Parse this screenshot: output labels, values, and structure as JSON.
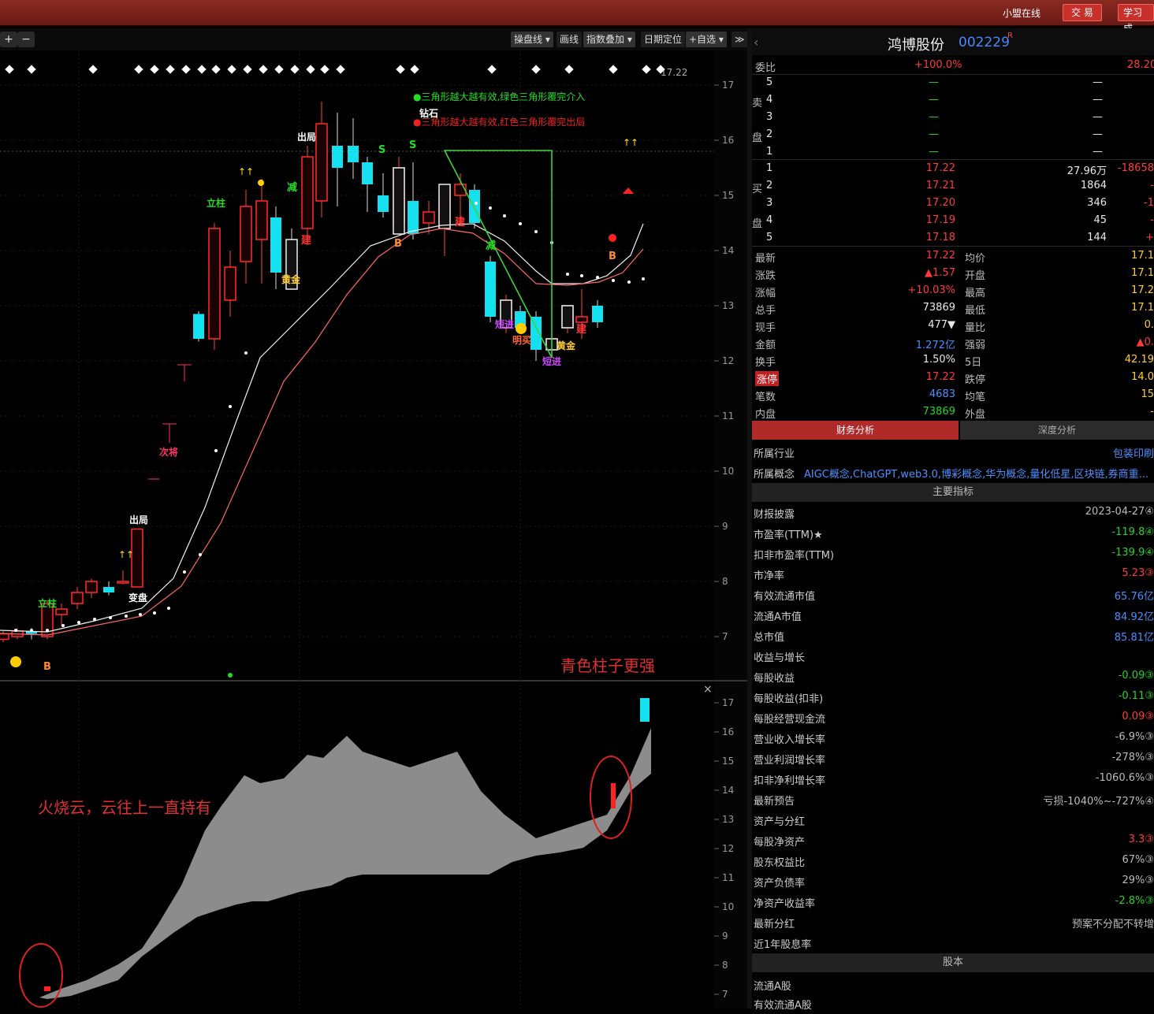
{
  "topbar": {
    "online": "小盟在线",
    "trade": "交 易",
    "learn": "学习成"
  },
  "toolbar": {
    "zoom_in": "+",
    "zoom_out": "−",
    "items": [
      "操盘线 ▾",
      "画线",
      "指数叠加 ▾",
      "日期定位",
      "+自选 ▾"
    ],
    "close": "≫"
  },
  "chart_data": {
    "type": "candlestick",
    "main": {
      "y_ticks": [
        17,
        16,
        15,
        14,
        13,
        12,
        11,
        10,
        9,
        8,
        7
      ],
      "current_price_label": "17.22",
      "legend": [
        {
          "text": "●三角形越大越有效,绿色三角形覆完介入",
          "color": "#22dd22"
        },
        {
          "text": "●三角形越大越有效,红色三角形覆完出局",
          "color": "#ee2222"
        }
      ],
      "annotations": [
        {
          "text": "钻石",
          "color": "#ffffff"
        },
        {
          "text": "出局",
          "color": "#ffffff"
        },
        {
          "text": "出局",
          "color": "#ffffff"
        },
        {
          "text": "立柱",
          "color": "#22dd22"
        },
        {
          "text": "立柱",
          "color": "#22dd22"
        },
        {
          "text": "减",
          "color": "#22dd22"
        },
        {
          "text": "减",
          "color": "#22dd22"
        },
        {
          "text": "建",
          "color": "#ff3333"
        },
        {
          "text": "建",
          "color": "#ff3333"
        },
        {
          "text": "建",
          "color": "#ff3333"
        },
        {
          "text": "黄金",
          "color": "#ffcc33"
        },
        {
          "text": "黄金",
          "color": "#ffcc33"
        },
        {
          "text": "变盘",
          "color": "#ffffff"
        },
        {
          "text": "次将",
          "color": "#ff3366"
        },
        {
          "text": "短进",
          "color": "#cc44ff"
        },
        {
          "text": "短进",
          "color": "#cc44ff"
        },
        {
          "text": "明买",
          "color": "#ff6633"
        },
        {
          "text": "B",
          "color": "#ff8833"
        },
        {
          "text": "B",
          "color": "#ff8833"
        },
        {
          "text": "B",
          "color": "#ff8833"
        },
        {
          "text": "S",
          "color": "#22dd22"
        },
        {
          "text": "S",
          "color": "#22dd22"
        }
      ],
      "note": "青色柱子更强",
      "candles": [
        {
          "o": 6.95,
          "c": 7.05,
          "h": 7.1,
          "l": 6.9
        },
        {
          "o": 7.0,
          "c": 7.1,
          "h": 7.15,
          "l": 6.95
        },
        {
          "o": 7.1,
          "c": 7.05,
          "h": 7.15,
          "l": 6.95
        },
        {
          "o": 7.0,
          "c": 7.6,
          "h": 7.65,
          "l": 6.95
        },
        {
          "o": 7.4,
          "c": 7.5,
          "h": 7.6,
          "l": 7.2
        },
        {
          "o": 7.6,
          "c": 7.8,
          "h": 7.9,
          "l": 7.5
        },
        {
          "o": 7.8,
          "c": 8.0,
          "h": 8.05,
          "l": 7.7
        },
        {
          "o": 7.9,
          "c": 7.8,
          "h": 8.0,
          "l": 7.75
        },
        {
          "o": 8.0,
          "c": 8.0,
          "h": 8.2,
          "l": 7.95
        },
        {
          "o": 7.9,
          "c": 8.95,
          "h": 8.95,
          "l": 7.9
        },
        {
          "o": 12.85,
          "c": 12.4,
          "h": 12.9,
          "l": 12.35
        },
        {
          "o": 12.4,
          "c": 14.4,
          "h": 14.5,
          "l": 12.2
        },
        {
          "o": 13.1,
          "c": 13.7,
          "h": 14.0,
          "l": 12.8
        },
        {
          "o": 13.8,
          "c": 14.8,
          "h": 15.1,
          "l": 13.4
        },
        {
          "o": 14.2,
          "c": 14.9,
          "h": 15.3,
          "l": 13.4
        },
        {
          "o": 14.6,
          "c": 13.6,
          "h": 14.8,
          "l": 13.3
        },
        {
          "o": 14.2,
          "c": 13.6,
          "h": 14.4,
          "l": 13.3
        },
        {
          "o": 14.4,
          "c": 15.7,
          "h": 15.9,
          "l": 14.1
        },
        {
          "o": 14.9,
          "c": 16.3,
          "h": 16.7,
          "l": 14.6
        },
        {
          "o": 15.9,
          "c": 15.5,
          "h": 16.5,
          "l": 14.8
        },
        {
          "o": 15.9,
          "c": 15.6,
          "h": 16.4,
          "l": 15.3
        },
        {
          "o": 15.6,
          "c": 15.2,
          "h": 15.7,
          "l": 14.7
        },
        {
          "o": 15.0,
          "c": 14.7,
          "h": 15.4,
          "l": 14.6
        },
        {
          "o": 14.5,
          "c": 15.5,
          "h": 15.7,
          "l": 14.4
        },
        {
          "o": 14.9,
          "c": 14.3,
          "h": 15.6,
          "l": 14.2
        },
        {
          "o": 14.5,
          "c": 14.7,
          "h": 14.9,
          "l": 14.3
        },
        {
          "o": 14.4,
          "c": 15.1,
          "h": 15.2,
          "l": 13.9
        },
        {
          "o": 15.0,
          "c": 15.2,
          "h": 15.4,
          "l": 14.5
        },
        {
          "o": 15.1,
          "c": 14.5,
          "h": 15.2,
          "l": 14.4
        },
        {
          "o": 13.8,
          "c": 12.8,
          "h": 13.9,
          "l": 12.7
        },
        {
          "o": 12.6,
          "c": 13.1,
          "h": 13.2,
          "l": 12.5
        },
        {
          "o": 12.9,
          "c": 12.6,
          "h": 13.0,
          "l": 12.5
        },
        {
          "o": 12.8,
          "c": 12.2,
          "h": 12.9,
          "l": 12.0
        },
        {
          "o": 12.2,
          "c": 12.4,
          "h": 12.5,
          "l": 12.1
        },
        {
          "o": 12.6,
          "c": 13.0,
          "h": 13.0,
          "l": 12.5
        },
        {
          "o": 12.7,
          "c": 12.8,
          "h": 13.3,
          "l": 12.4
        },
        {
          "o": 13.0,
          "c": 12.7,
          "h": 13.1,
          "l": 12.6
        }
      ]
    },
    "sub": {
      "y_ticks": [
        17,
        16,
        15,
        14,
        13,
        12,
        11,
        10,
        9,
        8,
        7
      ],
      "note": "火烧云，云往上一直持有"
    }
  },
  "quote": {
    "name": "鸿博股份",
    "code": "002229",
    "flag": "R",
    "weibi": {
      "label": "委比",
      "value": "+100.0%",
      "right": "28.20"
    },
    "sell_tag": [
      "卖",
      "盘"
    ],
    "buy_tag": [
      "买",
      "盘"
    ],
    "sell": [
      {
        "lvl": "5",
        "price": "—",
        "vol": "—"
      },
      {
        "lvl": "4",
        "price": "—",
        "vol": "—"
      },
      {
        "lvl": "3",
        "price": "—",
        "vol": "—"
      },
      {
        "lvl": "2",
        "price": "—",
        "vol": "—"
      },
      {
        "lvl": "1",
        "price": "—",
        "vol": "—"
      }
    ],
    "buy": [
      {
        "lvl": "1",
        "price": "17.22",
        "vol": "27.96万",
        "chg": "-18658"
      },
      {
        "lvl": "2",
        "price": "17.21",
        "vol": "1864",
        "chg": "-"
      },
      {
        "lvl": "3",
        "price": "17.20",
        "vol": "346",
        "chg": "-1"
      },
      {
        "lvl": "4",
        "price": "17.19",
        "vol": "45",
        "chg": "-"
      },
      {
        "lvl": "5",
        "price": "17.18",
        "vol": "144",
        "chg": "+"
      }
    ],
    "stats": [
      {
        "k1": "最新",
        "v1": "17.22",
        "c1": "red",
        "k2": "均价",
        "v2": "17.1"
      },
      {
        "k1": "涨跌",
        "v1": "▲1.57",
        "c1": "red",
        "k2": "开盘",
        "v2": "17.1"
      },
      {
        "k1": "涨幅",
        "v1": "+10.03%",
        "c1": "red",
        "k2": "最高",
        "v2": "17.2"
      },
      {
        "k1": "总手",
        "v1": "73869",
        "c1": "wht",
        "k2": "最低",
        "v2": "17.1"
      },
      {
        "k1": "现手",
        "v1": "477▼",
        "c1": "wht",
        "k2": "量比",
        "v2": "0."
      },
      {
        "k1": "金额",
        "v1": "1.272亿",
        "c1": "blu",
        "k2": "强弱",
        "v2": "▲0."
      },
      {
        "k1": "换手",
        "v1": "1.50%",
        "c1": "wht",
        "k2": "5日",
        "v2": "42.19"
      },
      {
        "k1": "涨停",
        "v1": "17.22",
        "c1": "red",
        "k2": "跌停",
        "v2": "14.0"
      },
      {
        "k1": "笔数",
        "v1": "4683",
        "c1": "blu",
        "k2": "均笔",
        "v2": "15"
      },
      {
        "k1": "内盘",
        "v1": "73869",
        "c1": "grn",
        "k2": "外盘",
        "v2": "-"
      }
    ],
    "tabs": [
      "财务分析",
      "深度分析"
    ],
    "industry": {
      "label": "所属行业",
      "value": "包装印刷"
    },
    "concept": {
      "label": "所属概念",
      "value": "AIGC概念,ChatGPT,web3.0,博彩概念,华为概念,量化低星,区块链,券商重..."
    },
    "sect_main": "主要指标",
    "fin": [
      {
        "k": "财报披露",
        "v": "2023-04-27④",
        "c": "gry"
      },
      {
        "k": "市盈率(TTM)★",
        "v": "-119.8④",
        "c": "grn"
      },
      {
        "k": "扣非市盈率(TTM)",
        "v": "-139.9④",
        "c": "grn"
      },
      {
        "k": "市净率",
        "v": "5.23③",
        "c": "red"
      },
      {
        "k": "有效流通市值",
        "v": "65.76亿",
        "c": "blu"
      },
      {
        "k": "流通A市值",
        "v": "84.92亿",
        "c": "blu"
      },
      {
        "k": "总市值",
        "v": "85.81亿",
        "c": "blu"
      },
      {
        "k": "收益与增长",
        "v": "",
        "c": "gry"
      },
      {
        "k": "每股收益",
        "v": "-0.09③",
        "c": "grn"
      },
      {
        "k": "每股收益(扣非)",
        "v": "-0.11③",
        "c": "grn"
      },
      {
        "k": "每股经营现金流",
        "v": "0.09③",
        "c": "red"
      },
      {
        "k": "营业收入增长率",
        "v": "-6.9%③",
        "c": "gry"
      },
      {
        "k": "营业利润增长率",
        "v": "-278%③",
        "c": "gry"
      },
      {
        "k": "扣非净利增长率",
        "v": "-1060.6%③",
        "c": "gry"
      },
      {
        "k": "最新预告",
        "v": "亏损-1040%~-727%④",
        "c": "gry"
      },
      {
        "k": "资产与分红",
        "v": "",
        "c": "gry"
      },
      {
        "k": "每股净资产",
        "v": "3.3③",
        "c": "red"
      },
      {
        "k": "股东权益比",
        "v": "67%③",
        "c": "gry"
      },
      {
        "k": "资产负债率",
        "v": "29%③",
        "c": "gry"
      },
      {
        "k": "净资产收益率",
        "v": "-2.8%③",
        "c": "grn"
      },
      {
        "k": "最新分红",
        "v": "预案不分配不转增",
        "c": "gry"
      },
      {
        "k": "近1年股息率",
        "v": "",
        "c": "gry"
      }
    ],
    "sect_capital": "股本",
    "capital": [
      {
        "k": "流通A股",
        "v": ""
      },
      {
        "k": "有效流通A股",
        "v": ""
      }
    ]
  }
}
